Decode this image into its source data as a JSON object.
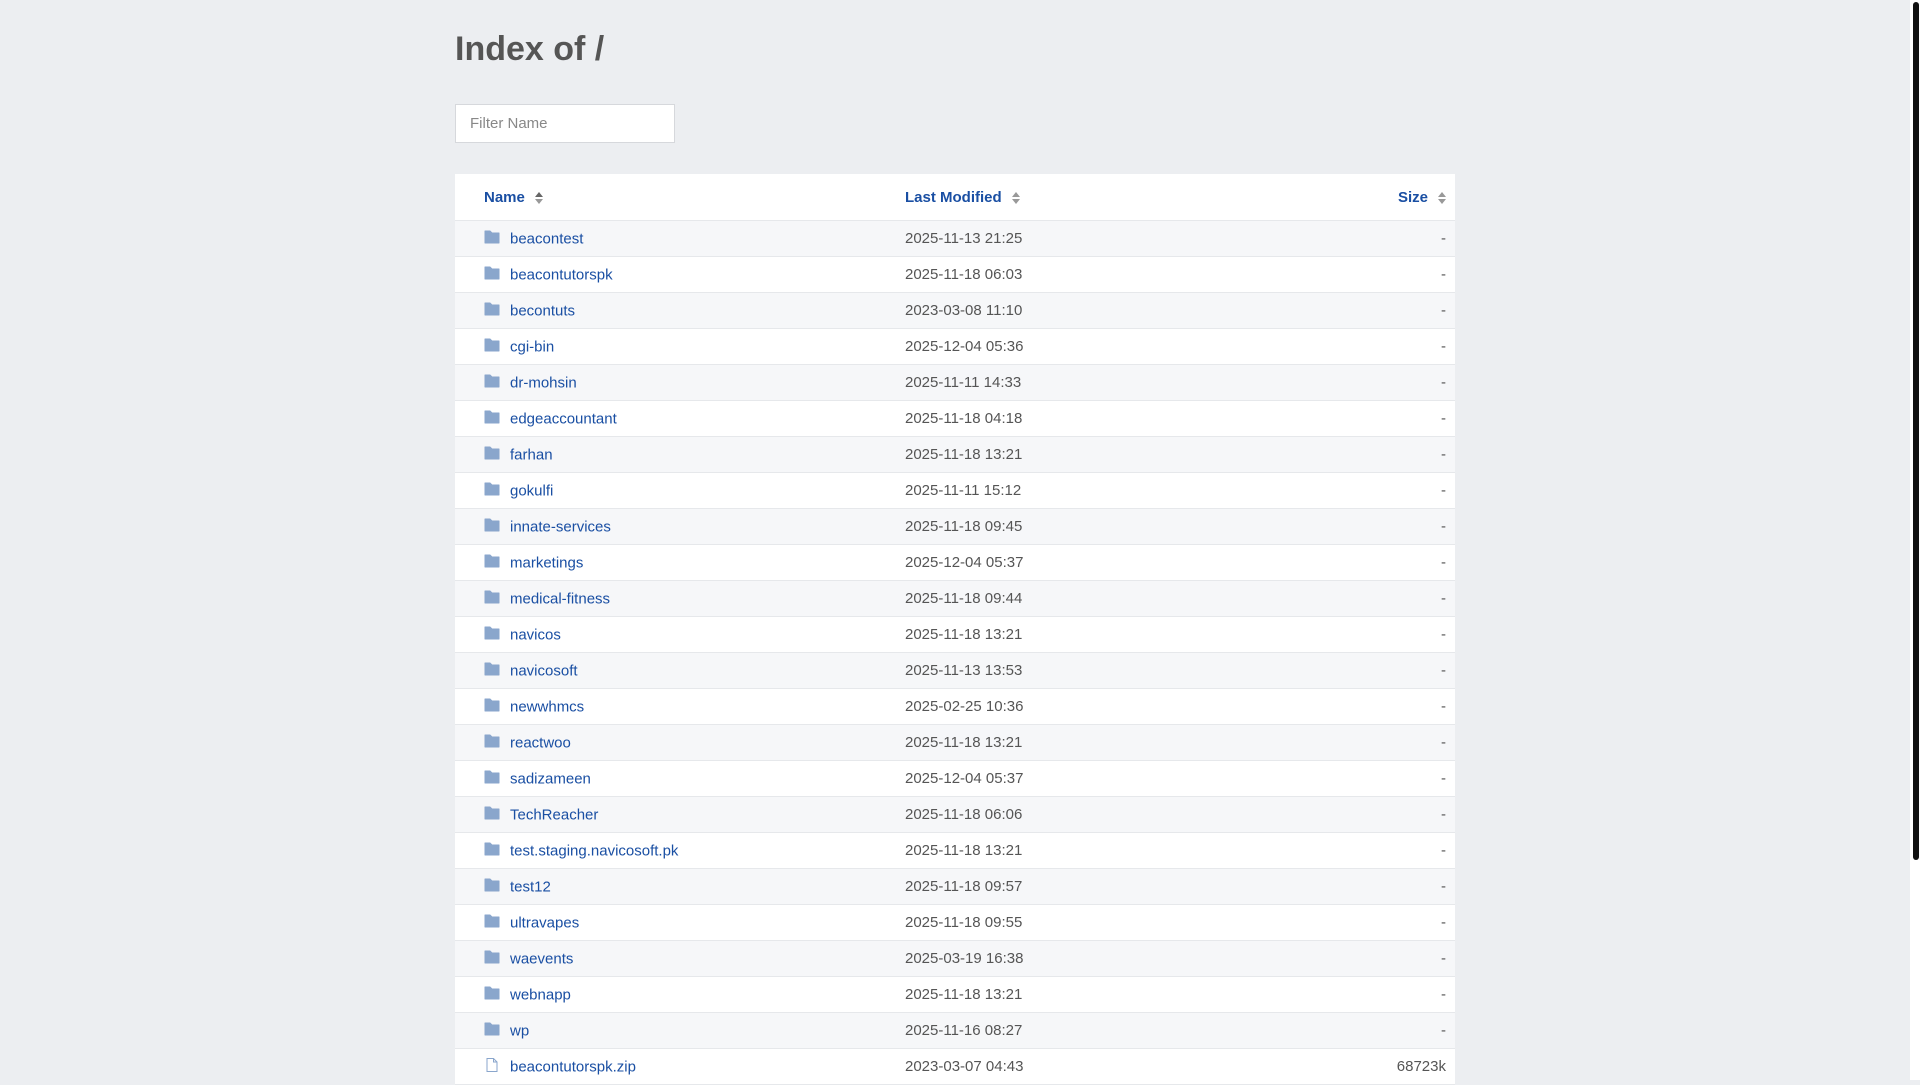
{
  "title": "Index of /",
  "filter": {
    "placeholder": "Filter Name",
    "value": ""
  },
  "headers": {
    "name": "Name",
    "modified": "Last Modified",
    "size": "Size"
  },
  "colors": {
    "link": "#1a4fa3",
    "folder": "#8aa6cc",
    "background": "#eceef1"
  },
  "rows": [
    {
      "type": "folder",
      "name": "beacontest",
      "modified": "2025-11-13 21:25",
      "size": "-"
    },
    {
      "type": "folder",
      "name": "beacontutorspk",
      "modified": "2025-11-18 06:03",
      "size": "-"
    },
    {
      "type": "folder",
      "name": "becontuts",
      "modified": "2023-03-08 11:10",
      "size": "-"
    },
    {
      "type": "folder",
      "name": "cgi-bin",
      "modified": "2025-12-04 05:36",
      "size": "-"
    },
    {
      "type": "folder",
      "name": "dr-mohsin",
      "modified": "2025-11-11 14:33",
      "size": "-"
    },
    {
      "type": "folder",
      "name": "edgeaccountant",
      "modified": "2025-11-18 04:18",
      "size": "-"
    },
    {
      "type": "folder",
      "name": "farhan",
      "modified": "2025-11-18 13:21",
      "size": "-"
    },
    {
      "type": "folder",
      "name": "gokulfi",
      "modified": "2025-11-11 15:12",
      "size": "-"
    },
    {
      "type": "folder",
      "name": "innate-services",
      "modified": "2025-11-18 09:45",
      "size": "-"
    },
    {
      "type": "folder",
      "name": "marketings",
      "modified": "2025-12-04 05:37",
      "size": "-"
    },
    {
      "type": "folder",
      "name": "medical-fitness",
      "modified": "2025-11-18 09:44",
      "size": "-"
    },
    {
      "type": "folder",
      "name": "navicos",
      "modified": "2025-11-18 13:21",
      "size": "-"
    },
    {
      "type": "folder",
      "name": "navicosoft",
      "modified": "2025-11-13 13:53",
      "size": "-"
    },
    {
      "type": "folder",
      "name": "newwhmcs",
      "modified": "2025-02-25 10:36",
      "size": "-"
    },
    {
      "type": "folder",
      "name": "reactwoo",
      "modified": "2025-11-18 13:21",
      "size": "-"
    },
    {
      "type": "folder",
      "name": "sadizameen",
      "modified": "2025-12-04 05:37",
      "size": "-"
    },
    {
      "type": "folder",
      "name": "TechReacher",
      "modified": "2025-11-18 06:06",
      "size": "-"
    },
    {
      "type": "folder",
      "name": "test.staging.navicosoft.pk",
      "modified": "2025-11-18 13:21",
      "size": "-"
    },
    {
      "type": "folder",
      "name": "test12",
      "modified": "2025-11-18 09:57",
      "size": "-"
    },
    {
      "type": "folder",
      "name": "ultravapes",
      "modified": "2025-11-18 09:55",
      "size": "-"
    },
    {
      "type": "folder",
      "name": "waevents",
      "modified": "2025-03-19 16:38",
      "size": "-"
    },
    {
      "type": "folder",
      "name": "webnapp",
      "modified": "2025-11-18 13:21",
      "size": "-"
    },
    {
      "type": "folder",
      "name": "wp",
      "modified": "2025-11-16 08:27",
      "size": "-"
    },
    {
      "type": "file",
      "name": "beacontutorspk.zip",
      "modified": "2023-03-07 04:43",
      "size": "68723k"
    }
  ]
}
